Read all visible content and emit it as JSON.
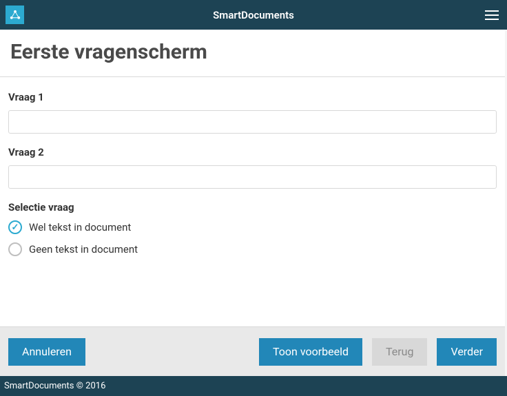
{
  "header": {
    "title": "SmartDocuments"
  },
  "page": {
    "title": "Eerste vragenscherm"
  },
  "fields": {
    "q1_label": "Vraag 1",
    "q1_value": "",
    "q2_label": "Vraag 2",
    "q2_value": "",
    "select_label": "Selectie vraag",
    "opt1_label": "Wel tekst in document",
    "opt2_label": "Geen tekst in document"
  },
  "buttons": {
    "cancel": "Annuleren",
    "preview": "Toon voorbeeld",
    "back": "Terug",
    "next": "Verder"
  },
  "footer": {
    "text": "SmartDocuments © 2016"
  }
}
